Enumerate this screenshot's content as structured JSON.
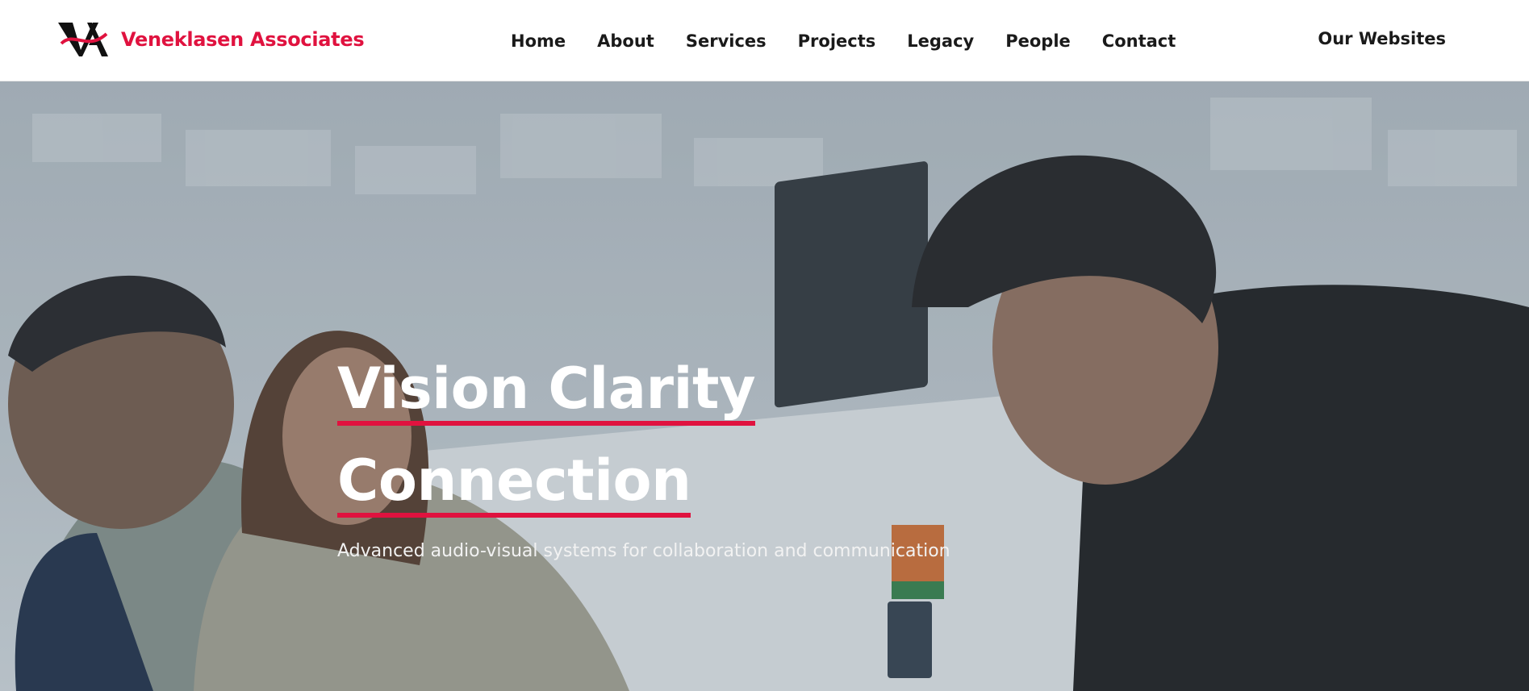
{
  "header": {
    "logo": {
      "initials": "VA",
      "name": "Veneklasen Associates",
      "icon": "va-logo-mark"
    },
    "nav": [
      "Home",
      "About",
      "Services",
      "Projects",
      "Legacy",
      "People",
      "Contact"
    ],
    "websites_label": "Our Websites"
  },
  "hero": {
    "title_line1": "Vision Clarity",
    "title_line2": "Connection",
    "subtitle": "Advanced audio-visual systems for collaboration and communication"
  },
  "colors": {
    "accent": "#e0123f",
    "text": "#1a1a1a",
    "overlay": "#8f9ba4"
  }
}
